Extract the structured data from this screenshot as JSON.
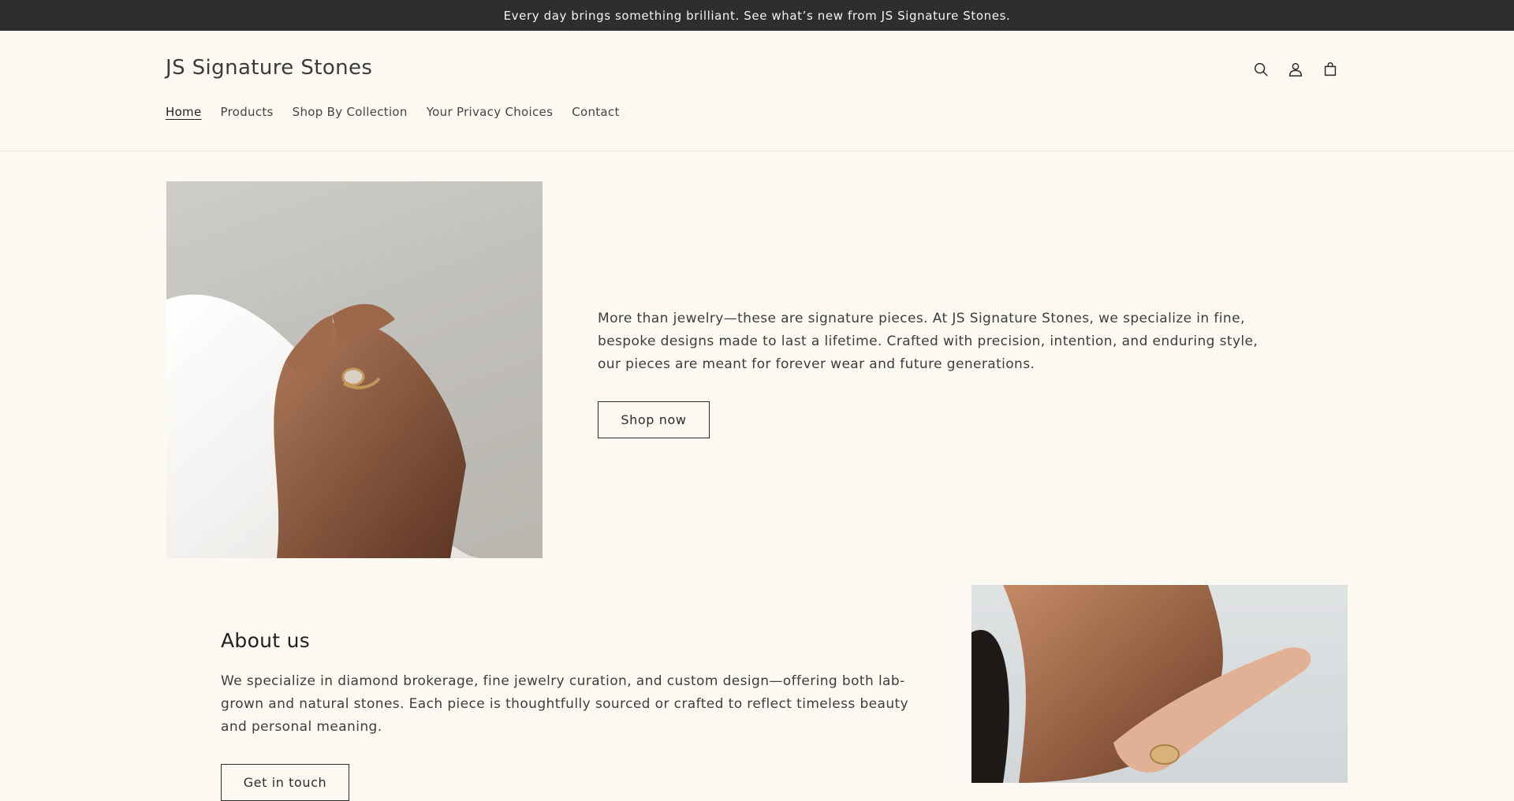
{
  "announcement": "Every day brings something brilliant. See what’s new from JS Signature Stones.",
  "header": {
    "logo": "JS Signature Stones",
    "nav": [
      {
        "label": "Home",
        "active": true
      },
      {
        "label": "Products",
        "active": false
      },
      {
        "label": "Shop By Collection",
        "active": false
      },
      {
        "label": "Your Privacy Choices",
        "active": false
      },
      {
        "label": "Contact",
        "active": false
      }
    ],
    "icons": [
      "search-icon",
      "account-icon",
      "cart-icon"
    ]
  },
  "hero": {
    "text": "More than jewelry—these are signature pieces. At JS Signature Stones, we specialize in fine, bespoke designs made to last a lifetime. Crafted with precision, intention, and enduring style, our pieces are meant for forever wear and future generations.",
    "button": "Shop now"
  },
  "about": {
    "title": "About us",
    "text": "We specialize in diamond brokerage, fine jewelry curation, and custom design—offering both lab-grown and natural stones. Each piece is thoughtfully sourced or crafted to reflect timeless beauty and personal meaning.",
    "button": "Get in touch"
  },
  "colors": {
    "background": "#fbf9f2",
    "announcement_bar": "#2e2e2e",
    "text": "#2b2b2b"
  }
}
